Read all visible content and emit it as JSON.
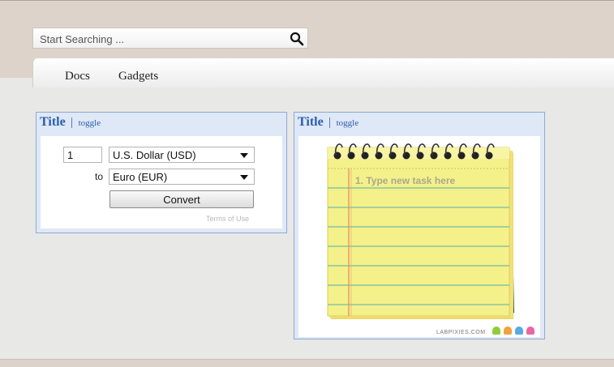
{
  "search": {
    "placeholder": "Start Searching ...",
    "icon": "magnifier"
  },
  "tabs": [
    {
      "label": "Docs"
    },
    {
      "label": "Gadgets"
    }
  ],
  "gadgets": [
    {
      "title": "Title",
      "separator": "|",
      "toggle": "toggle",
      "converter": {
        "amount": "1",
        "from_currency": "U.S. Dollar (USD)",
        "to_label": "to",
        "to_currency": "Euro (EUR)",
        "convert_label": "Convert",
        "terms_label": "Terms of Use"
      }
    },
    {
      "title": "Title",
      "separator": "|",
      "toggle": "toggle",
      "notepad": {
        "task_placeholder": "1. Type new task here",
        "brand": "LABPIXIES.COM",
        "monster_colors": [
          "#8fce3a",
          "#f0a23c",
          "#5aa8e6",
          "#e866a6"
        ]
      }
    }
  ],
  "colors": {
    "topbar": "#ddd3cb",
    "gadget_header": "#dfe8f6",
    "title_blue": "#2a5db0",
    "notepad_yellow": "#f3ef8a"
  }
}
